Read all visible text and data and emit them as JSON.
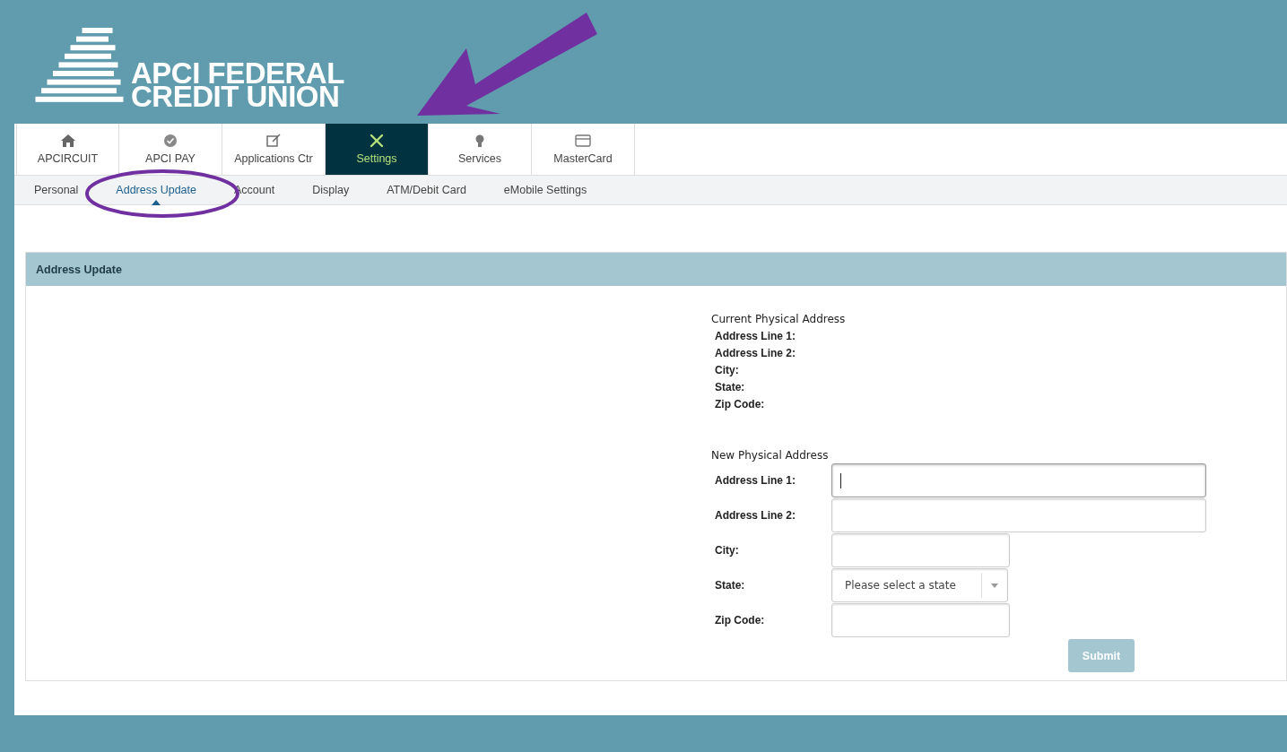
{
  "logo": {
    "lines": [
      "APCI FEDERAL",
      "CREDIT UNION"
    ]
  },
  "tabs": [
    {
      "label": "APCIRCUIT",
      "selected": false
    },
    {
      "label": "APCI PAY",
      "selected": false
    },
    {
      "label": "Applications Ctr",
      "selected": false
    },
    {
      "label": "Settings",
      "selected": true
    },
    {
      "label": "Services",
      "selected": false
    },
    {
      "label": "MasterCard",
      "selected": false
    }
  ],
  "subtabs": [
    {
      "label": "Personal",
      "selected": false
    },
    {
      "label": "Address Update",
      "selected": true
    },
    {
      "label": "Account",
      "selected": false
    },
    {
      "label": "Display",
      "selected": false
    },
    {
      "label": "ATM/Debit Card",
      "selected": false
    },
    {
      "label": "eMobile Settings",
      "selected": false
    }
  ],
  "panel": {
    "title": "Address Update"
  },
  "current_address": {
    "heading": "Current Physical Address",
    "fields": [
      "Address Line 1:",
      "Address Line 2:",
      "City:",
      "State:",
      "Zip Code:"
    ]
  },
  "new_address": {
    "heading": "New Physical Address",
    "fields": [
      {
        "label": "Address Line 1:",
        "kind": "text",
        "focused": true
      },
      {
        "label": "Address Line 2:",
        "kind": "text",
        "focused": false
      },
      {
        "label": "City:",
        "kind": "text",
        "focused": false
      },
      {
        "label": "State:",
        "kind": "select",
        "focused": false,
        "placeholder": "Please select a state"
      },
      {
        "label": "Zip Code:",
        "kind": "text",
        "focused": false
      }
    ]
  },
  "submit": {
    "label": "Submit",
    "disabled": true
  },
  "annotations": {
    "arrow": true,
    "ellipse": true
  }
}
